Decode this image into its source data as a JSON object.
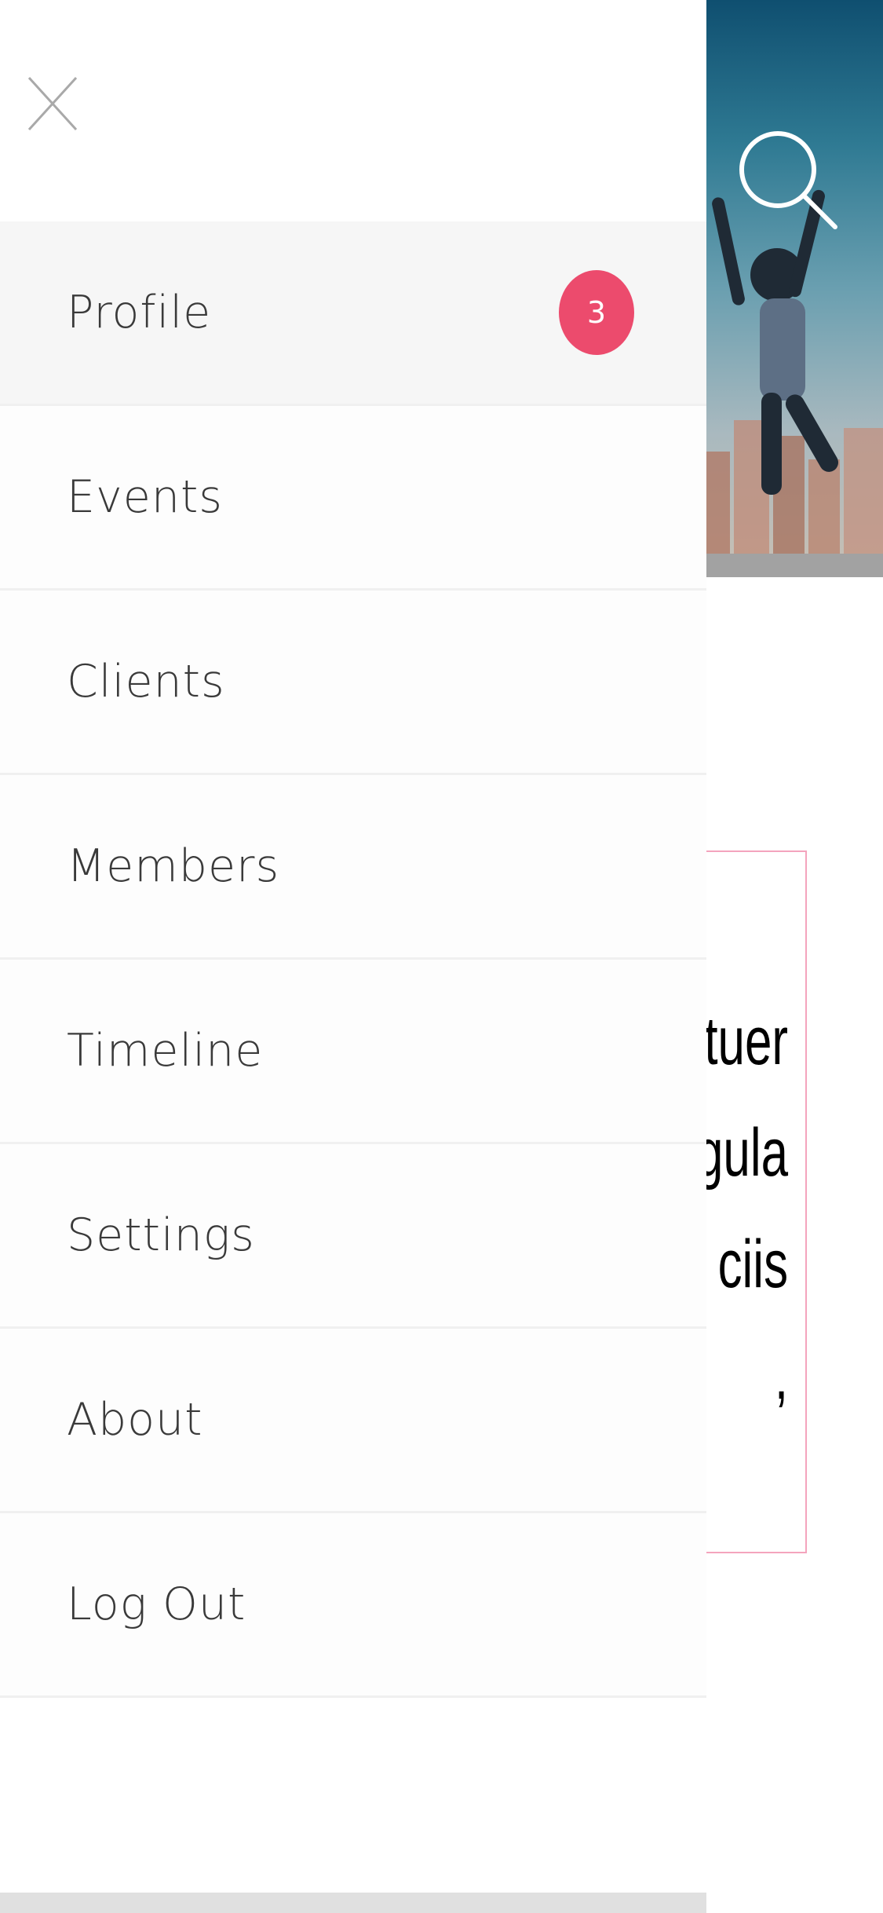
{
  "background": {
    "card_text": "etuer\ngula\nciis\n,"
  },
  "drawer": {
    "menu": [
      {
        "label": "Profile",
        "badge": "3",
        "active": true
      },
      {
        "label": "Events"
      },
      {
        "label": "Clients"
      },
      {
        "label": "Members"
      },
      {
        "label": "Timeline"
      },
      {
        "label": "Settings"
      },
      {
        "label": "About"
      },
      {
        "label": "Log Out"
      }
    ]
  },
  "icons": {
    "close": "close-icon",
    "search": "search-icon"
  },
  "colors": {
    "badge": "#ec4b6d",
    "card_border": "#f4a4bd",
    "menu_active_bg": "#f6f6f6",
    "menu_text": "#3a3a3a"
  }
}
